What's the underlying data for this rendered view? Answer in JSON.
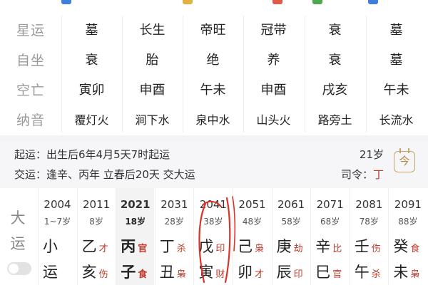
{
  "attributes": {
    "rows": [
      {
        "label": "星运",
        "cells": [
          "墓",
          "长生",
          "帝旺",
          "冠带",
          "衰",
          "墓"
        ]
      },
      {
        "label": "自坐",
        "cells": [
          "衰",
          "胎",
          "绝",
          "养",
          "衰",
          "墓"
        ]
      },
      {
        "label": "空亡",
        "cells": [
          "寅卯",
          "申酉",
          "午未",
          "申酉",
          "戌亥",
          "午未"
        ]
      },
      {
        "label": "纳音",
        "cells": [
          "覆灯火",
          "涧下水",
          "泉中水",
          "山头火",
          "路旁土",
          "长流水"
        ]
      }
    ]
  },
  "yun_info": {
    "qiyun": "起运：出生后6年4月5天7时起运",
    "jiaoyun": "交运：逢辛、丙年 立春后20天 交大运",
    "start_age": "21岁",
    "siling_label": "司令：",
    "siling_value": "丁",
    "calendar_icon_char": "今"
  },
  "dayun": {
    "title_chars": [
      "大",
      "运"
    ],
    "columns": [
      {
        "year": "2004",
        "age": "1~7岁",
        "gan": "小",
        "gan_tag": "",
        "zhi": "运",
        "zhi_tag": "",
        "active": false
      },
      {
        "year": "2011",
        "age": "8岁",
        "gan": "乙",
        "gan_tag": "才",
        "zhi": "亥",
        "zhi_tag": "伤",
        "active": false
      },
      {
        "year": "2021",
        "age": "18岁",
        "gan": "丙",
        "gan_tag": "官",
        "zhi": "子",
        "zhi_tag": "食",
        "active": true
      },
      {
        "year": "2031",
        "age": "28岁",
        "gan": "丁",
        "gan_tag": "杀",
        "zhi": "丑",
        "zhi_tag": "枭",
        "active": false
      },
      {
        "year": "2041",
        "age": "38岁",
        "gan": "戊",
        "gan_tag": "印",
        "zhi": "寅",
        "zhi_tag": "财",
        "active": false
      },
      {
        "year": "2051",
        "age": "48岁",
        "gan": "己",
        "gan_tag": "枭",
        "zhi": "卯",
        "zhi_tag": "才",
        "active": false
      },
      {
        "year": "2061",
        "age": "58岁",
        "gan": "庚",
        "gan_tag": "劫",
        "zhi": "辰",
        "zhi_tag": "印",
        "active": false
      },
      {
        "year": "2071",
        "age": "68岁",
        "gan": "辛",
        "gan_tag": "比",
        "zhi": "巳",
        "zhi_tag": "官",
        "active": false
      },
      {
        "year": "2081",
        "age": "78岁",
        "gan": "壬",
        "gan_tag": "伤",
        "zhi": "午",
        "zhi_tag": "杀",
        "active": false
      },
      {
        "year": "2091",
        "age": "88岁",
        "gan": "癸",
        "gan_tag": "食",
        "zhi": "未",
        "zhi_tag": "枭",
        "active": false
      }
    ]
  },
  "colors": {
    "accent_red": "#c0392b",
    "label_gray": "#9a9a9a",
    "calendar_gold": "#c8a46a",
    "pen_red": "#d9342b"
  }
}
